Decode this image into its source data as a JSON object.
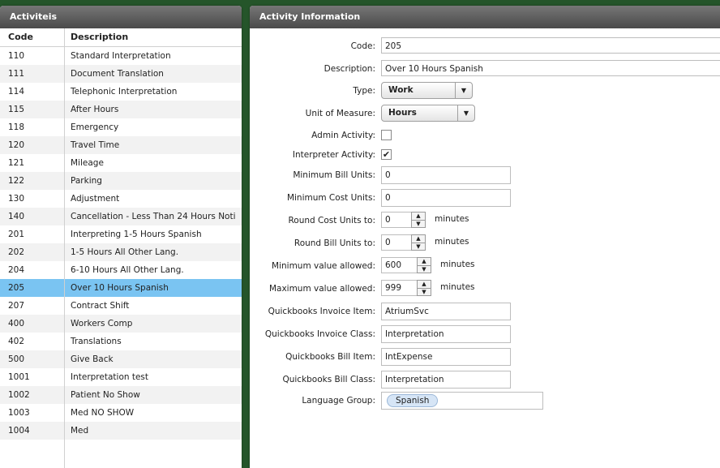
{
  "left_panel": {
    "title": "Activiteis",
    "columns": {
      "code": "Code",
      "description": "Description"
    },
    "selected_code": "205",
    "rows": [
      {
        "code": "110",
        "description": "Standard Interpretation"
      },
      {
        "code": "111",
        "description": "Document Translation"
      },
      {
        "code": "114",
        "description": "Telephonic Interpretation"
      },
      {
        "code": "115",
        "description": "After Hours"
      },
      {
        "code": "118",
        "description": "Emergency"
      },
      {
        "code": "120",
        "description": "Travel Time"
      },
      {
        "code": "121",
        "description": "Mileage"
      },
      {
        "code": "122",
        "description": "Parking"
      },
      {
        "code": "130",
        "description": "Adjustment"
      },
      {
        "code": "140",
        "description": "Cancellation - Less Than 24 Hours Noti"
      },
      {
        "code": "201",
        "description": "Interpreting 1-5 Hours Spanish"
      },
      {
        "code": "202",
        "description": "1-5 Hours All Other Lang."
      },
      {
        "code": "204",
        "description": "6-10 Hours All Other Lang."
      },
      {
        "code": "205",
        "description": "Over 10 Hours Spanish"
      },
      {
        "code": "207",
        "description": "Contract Shift"
      },
      {
        "code": "400",
        "description": "Workers Comp"
      },
      {
        "code": "402",
        "description": "Translations"
      },
      {
        "code": "500",
        "description": "Give Back"
      },
      {
        "code": "1001",
        "description": "Interpretation test"
      },
      {
        "code": "1002",
        "description": "Patient No Show"
      },
      {
        "code": "1003",
        "description": "Med NO SHOW"
      },
      {
        "code": "1004",
        "description": "Med"
      }
    ]
  },
  "right_panel": {
    "title": "Activity Information",
    "code": {
      "label": "Code:",
      "value": "205"
    },
    "description": {
      "label": "Description:",
      "value": "Over 10 Hours Spanish"
    },
    "type": {
      "label": "Type:",
      "value": "Work"
    },
    "unit_of_measure": {
      "label": "Unit of Measure:",
      "value": "Hours"
    },
    "admin_activity": {
      "label": "Admin Activity:",
      "checked": false,
      "mark": ""
    },
    "interpreter_activity": {
      "label": "Interpreter Activity:",
      "checked": true,
      "mark": "✔"
    },
    "minimum_bill_units": {
      "label": "Minimum Bill Units:",
      "value": "0"
    },
    "minimum_cost_units": {
      "label": "Minimum Cost Units:",
      "value": "0"
    },
    "round_cost_units": {
      "label": "Round Cost Units to:",
      "value": "0",
      "unit": "minutes"
    },
    "round_bill_units": {
      "label": "Round Bill Units to:",
      "value": "0",
      "unit": "minutes"
    },
    "minimum_value": {
      "label": "Minimum  value allowed:",
      "value": "600",
      "unit": "minutes"
    },
    "maximum_value": {
      "label": "Maximum  value allowed:",
      "value": "999",
      "unit": "minutes"
    },
    "qb_invoice_item": {
      "label": "Quickbooks Invoice Item:",
      "value": "AtriumSvc"
    },
    "qb_invoice_class": {
      "label": "Quickbooks Invoice Class:",
      "value": "Interpretation"
    },
    "qb_bill_item": {
      "label": "Quickbooks Bill Item:",
      "value": "IntExpense"
    },
    "qb_bill_class": {
      "label": "Quickbooks Bill Class:",
      "value": "Interpretation"
    },
    "language_group": {
      "label": "Language Group:",
      "tags": [
        "Spanish"
      ]
    }
  },
  "colors": {
    "background": "#25552a",
    "header_gradient_top": "#767676",
    "header_gradient_bottom": "#4a4a4a",
    "selected_row": "#7ac4f2",
    "tag_background": "#d6e5f6"
  },
  "icons": {
    "dropdown": "chevron-down-icon",
    "spin_up": "arrow-up-icon",
    "spin_down": "arrow-down-icon",
    "check": "checkmark-icon"
  }
}
